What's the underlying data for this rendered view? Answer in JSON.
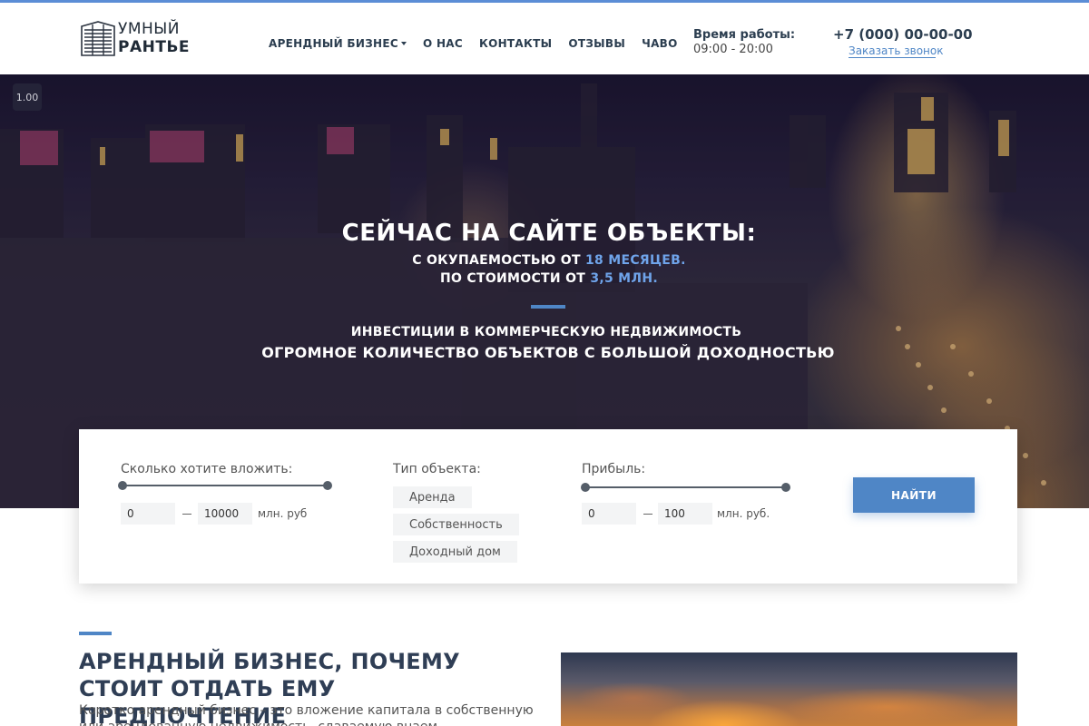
{
  "logo": {
    "line1": "УМНЫЙ",
    "line2": "РАНТЬЕ"
  },
  "nav": {
    "items": [
      {
        "label": "АРЕНДНЫЙ БИЗНЕС",
        "has_dropdown": true
      },
      {
        "label": "О НАС"
      },
      {
        "label": "КОНТАКТЫ"
      },
      {
        "label": "ОТЗЫВЫ"
      },
      {
        "label": "ЧАВО"
      }
    ]
  },
  "hours": {
    "title": "Время работы:",
    "value": "09:00 - 20:00"
  },
  "contact": {
    "phone": "+7 (000) 00-00-00",
    "callback": "Заказать звонок"
  },
  "hero": {
    "badge": "1.00",
    "title": "СЕЙЧАС НА САЙТЕ ОБЪЕКТЫ:",
    "line1_prefix": "С ОКУПАЕМОСТЬЮ ОТ ",
    "line1_highlight": "18 МЕСЯЦЕВ.",
    "line2_prefix": "ПО СТОИМОСТИ ОТ ",
    "line2_highlight": "3,5 МЛН.",
    "subtitle1": "ИНВЕСТИЦИИ В КОММЕРЧЕСКУЮ НЕДВИЖИМОСТЬ",
    "subtitle2": "ОГРОМНОЕ КОЛИЧЕСТВО ОБЪЕКТОВ С БОЛЬШОЙ ДОХОДНОСТЬЮ"
  },
  "filter": {
    "invest": {
      "label": "Сколько хотите вложить:",
      "from": "0",
      "to": "10000",
      "unit": "млн. руб"
    },
    "type": {
      "label": "Тип объекта:",
      "options": [
        "Аренда",
        "Собственность",
        "Доходный дом"
      ]
    },
    "profit": {
      "label": "Прибыль:",
      "from": "0",
      "to": "100",
      "unit": "млн. руб."
    },
    "submit": "НАЙТИ"
  },
  "section": {
    "title": "АРЕНДНЫЙ БИЗНЕС, ПОЧЕМУ СТОИТ ОТДАТЬ ЕМУ ПРЕДПОЧТЕНИЕ",
    "text": "Коротко арендный бизнес – это вложение капитала в собственную или арендованную недвижимость, сдаваемую внаем"
  },
  "colors": {
    "accent": "#4f86c6",
    "highlight": "#6fa4ea",
    "text_dark": "#2c3e50"
  }
}
